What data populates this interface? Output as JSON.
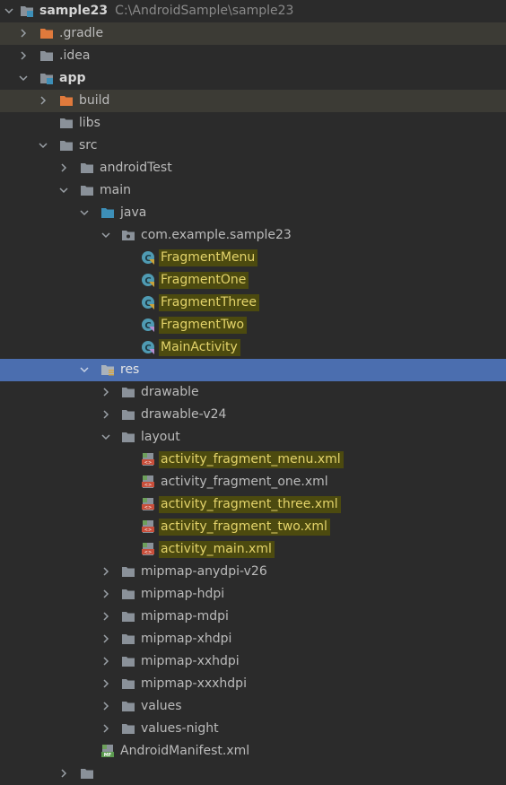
{
  "project": {
    "name": "sample23",
    "path": "C:\\AndroidSample\\sample23"
  },
  "nodes": {
    "gradle": ".gradle",
    "idea": ".idea",
    "app": "app",
    "build": "build",
    "libs": "libs",
    "src": "src",
    "androidTest": "androidTest",
    "main": "main",
    "java": "java",
    "package": "com.example.sample23",
    "classes": [
      "FragmentMenu",
      "FragmentOne",
      "FragmentThree",
      "FragmentTwo",
      "MainActivity"
    ],
    "res": "res",
    "drawable": "drawable",
    "drawable_v24": "drawable-v24",
    "layout": "layout",
    "layouts": [
      "activity_fragment_menu.xml",
      "activity_fragment_one.xml",
      "activity_fragment_three.xml",
      "activity_fragment_two.xml",
      "activity_main.xml"
    ],
    "mipmaps": [
      "mipmap-anydpi-v26",
      "mipmap-hdpi",
      "mipmap-mdpi",
      "mipmap-xhdpi",
      "mipmap-xxhdpi",
      "mipmap-xxxhdpi"
    ],
    "values": "values",
    "values_night": "values-night",
    "manifest": "AndroidManifest.xml"
  },
  "colors": {
    "background": "#2b2b2b",
    "selection": "#4b6eaf",
    "highlight_bg": "#4c4a0f",
    "highlight_text": "#e3d36a",
    "folder_gray": "#8a9199",
    "folder_orange": "#e07a3c",
    "folder_blue": "#3d8fb8",
    "class_circle": "#4f9bb3"
  },
  "icons": {
    "module": "module-folder-icon",
    "excluded": "excluded-folder-icon",
    "folder": "folder-icon",
    "source": "source-folder-icon",
    "package": "package-icon",
    "class": "class-icon",
    "resources": "resources-folder-icon",
    "layout_xml": "layout-xml-icon",
    "manifest": "manifest-icon"
  }
}
